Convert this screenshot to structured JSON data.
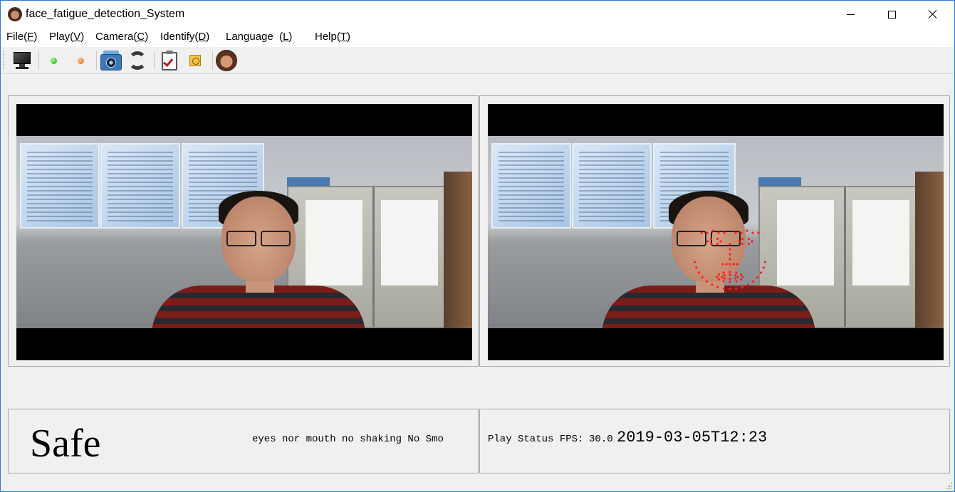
{
  "window": {
    "title": "face_fatigue_detection_System"
  },
  "menu": {
    "items": [
      {
        "label": "File(",
        "accel": "F",
        "close": ")"
      },
      {
        "label": "Play(",
        "accel": "V",
        "close": ")"
      },
      {
        "label": "Camera(",
        "accel": "C",
        "close": ")"
      },
      {
        "label": "Identify(",
        "accel": "D",
        "close": ")"
      },
      {
        "label": "Language  (",
        "accel": "L",
        "close": ")"
      },
      {
        "label": "Help(",
        "accel": "T",
        "close": ")"
      }
    ]
  },
  "toolbar": {
    "icons": [
      "monitor-icon",
      "green-dot-icon",
      "orange-dot-icon",
      "camera-icon",
      "refresh-icon",
      "clipboard-check-icon",
      "clock-icon",
      "face-photo-icon"
    ]
  },
  "status": {
    "state": "Safe",
    "state_detail": "eyes nor mouth no shaking No Smoki",
    "play_status": "Play Status FPS:",
    "fps": "30.0",
    "timestamp": "2019-03-05T12:23:("
  },
  "colors": {
    "landmark": "#ff2020",
    "window_border": "#2b79d8"
  }
}
